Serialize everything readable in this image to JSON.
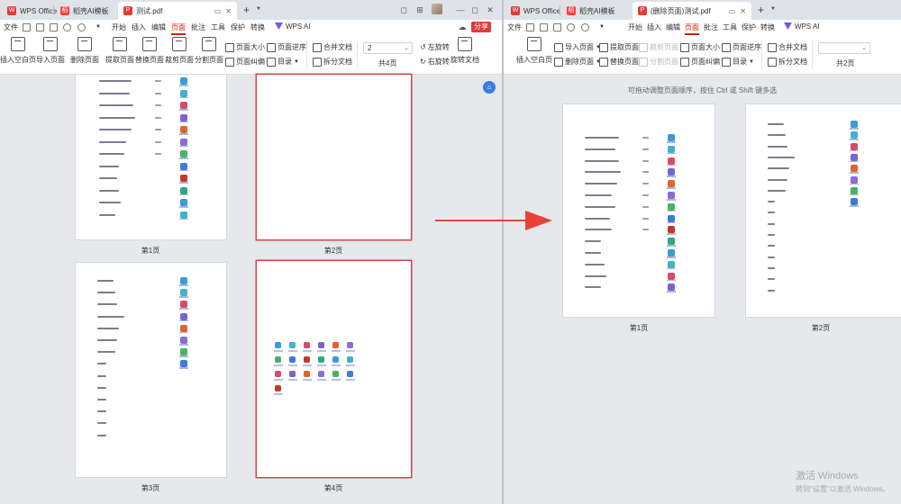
{
  "left": {
    "tabs": [
      {
        "label": "WPS Office"
      },
      {
        "label": "稻壳AI模板"
      },
      {
        "label": "测试.pdf"
      }
    ],
    "menu": [
      "文件",
      "开始",
      "插入",
      "编辑",
      "页面",
      "批注",
      "工具",
      "保护",
      "转换"
    ],
    "menu_active": "页面",
    "wps_ai": "WPS AI",
    "share": "分享",
    "ribbon": {
      "insert_blank": "插入空白页",
      "import_page": "导入页面",
      "delete_page": "删除页面",
      "extract_page": "提取页面",
      "replace_page": "替换页面",
      "crop_page": "裁剪页面",
      "split_page": "分割页面",
      "page_size": "页面大小",
      "page_border": "页面纠偏",
      "page_order": "页面逆序",
      "toc": "目录",
      "merge_doc": "合并文档",
      "split_doc": "拆分文档",
      "page_value": "2",
      "total_pages": "共4页",
      "rotate_left": "左旋转",
      "rotate_right": "右旋转",
      "rotate_doc": "旋转文档"
    },
    "pages": [
      {
        "label": "第1页"
      },
      {
        "label": "第2页"
      },
      {
        "label": "第3页"
      },
      {
        "label": "第4页"
      }
    ]
  },
  "right": {
    "tabs": [
      {
        "label": "WPS Office"
      },
      {
        "label": "稻壳AI模板"
      },
      {
        "label": "(删除页面)测试.pdf"
      }
    ],
    "menu": [
      "文件",
      "开始",
      "插入",
      "编辑",
      "页面",
      "批注",
      "工具",
      "保护",
      "转换"
    ],
    "menu_active": "页面",
    "wps_ai": "WPS AI",
    "ribbon": {
      "insert_blank": "插入空白页",
      "import_page": "导入页面",
      "delete_page": "删除页面",
      "extract_page": "提取页面",
      "replace_page": "替换页面",
      "crop_page": "裁剪页面",
      "split_page": "分割页面",
      "page_size": "页面大小",
      "page_border": "页面纠偏",
      "page_order": "页面逆序",
      "toc": "目录",
      "merge_doc": "合并文档",
      "split_doc": "拆分文档",
      "total_pages": "共2页"
    },
    "hint": "可拖动调整页面顺序，按住 Ctrl 或 Shift 键多选",
    "pages": [
      {
        "label": "第1页"
      },
      {
        "label": "第2页"
      }
    ]
  },
  "watermark": {
    "title": "激活 Windows",
    "subtitle": "转到\"设置\"以激活 Windows。"
  },
  "colors": {
    "accent": "#d81e06",
    "selected_border": "#d9404a",
    "arrow": "#e8413a"
  }
}
